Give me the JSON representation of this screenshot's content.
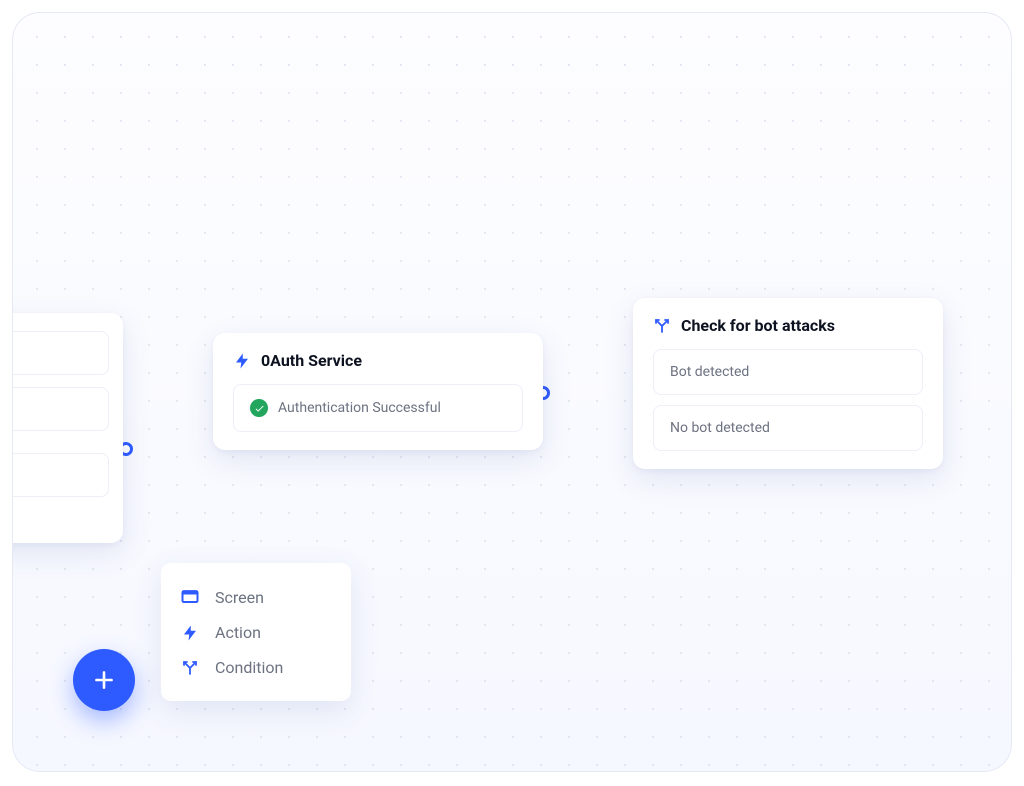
{
  "nodes": {
    "oauth": {
      "title": "0Auth Service",
      "outcome": "Authentication Successful"
    },
    "bot_check": {
      "title": "Check for bot attacks",
      "outcomes": [
        "Bot detected",
        "No bot detected"
      ]
    }
  },
  "palette": {
    "screen": "Screen",
    "action": "Action",
    "condition": "Condition"
  },
  "colors": {
    "accent": "#2e5bff",
    "success": "#22a55c"
  }
}
